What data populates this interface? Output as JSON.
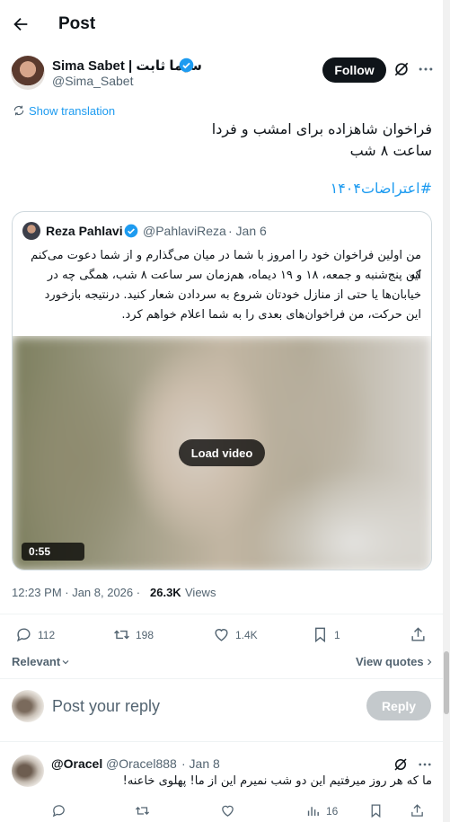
{
  "header": {
    "title": "Post"
  },
  "author": {
    "display_name": "Sima Sabet | سیما ثابت",
    "handle": "@Sima_Sabet",
    "follow_label": "Follow"
  },
  "post": {
    "show_translation": "Show translation",
    "line1": "فراخوان شاهزاده برای امشب و فردا",
    "line2": "ساعت ۸ شب",
    "hashtag": "#اعتراضات۱۴۰۴"
  },
  "quote": {
    "name": "Reza Pahlavi",
    "handle": "@PahlaviReza",
    "date": "· Jan 6",
    "lines": [
      "من اولین فراخوان خود را امروز با شما در میان می‌گذارم و از شما دعوت می‌کنم که",
      "این پنج‌شنبه و جمعه، ۱۸ و ۱۹ دیماه، هم‌زمان سر ساعت ۸ شب، همگی چه در",
      "خیابان‌ها یا حتی از منازل خودتان شروع به سردادن شعار کنید. درنتیجه بازخورد",
      "این حرکت، من فراخوان‌های بعدی را به شما اعلام خواهم کرد."
    ],
    "load_video": "Load video",
    "duration": "0:55"
  },
  "meta": {
    "time": "12:23 PM · Jan 8, 2026 ·",
    "views_count": "26.3K",
    "views_label": "Views"
  },
  "actions": {
    "replies": "112",
    "reposts": "198",
    "likes": "1.4K",
    "bookmarks": "1"
  },
  "sort": {
    "relevant": "Relevant",
    "view_quotes": "View quotes"
  },
  "reply_box": {
    "placeholder": "Post your reply",
    "button": "Reply"
  },
  "comment": {
    "name": "@Oracel",
    "handle": "@Oracel888",
    "date": "· Jan 8",
    "text": "ما که هر روز میرفتیم این دو شب نمیرم این از ما! پهلوی خاعنه!",
    "views": "16"
  },
  "colors": {
    "accent": "#1d9bf0",
    "text": "#0f1419",
    "muted": "#536471",
    "border": "#cfd9de"
  }
}
